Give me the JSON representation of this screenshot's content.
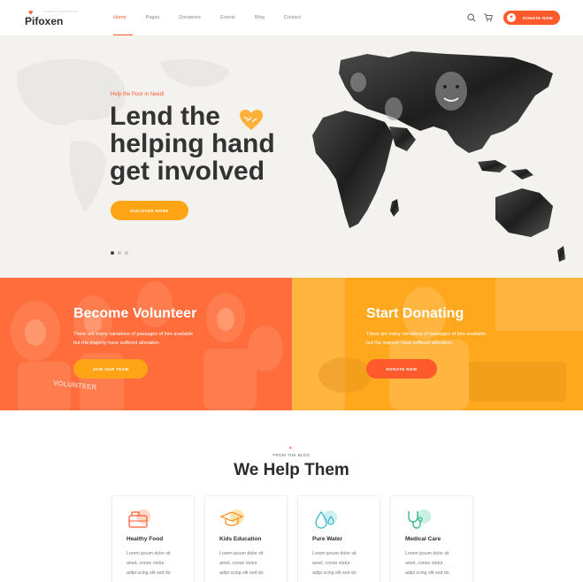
{
  "brand": {
    "name": "Pifoxen",
    "tagline": "CHARITY & DONATION"
  },
  "nav": {
    "items": [
      "Home",
      "Pages",
      "Donations",
      "Events",
      "Blog",
      "Contact"
    ],
    "active": "Home"
  },
  "header": {
    "donate_label": "DONATE NOW"
  },
  "hero": {
    "tagline": "Help the Poor in Need!",
    "title_line1": "Lend the",
    "title_line2": "helping hand",
    "title_line3": "get involved",
    "button_label": "DISCOVER MORE",
    "slides_count": 3,
    "active_slide": 1
  },
  "volunteer": {
    "title": "Become Volunteer",
    "text_line1": "There are many variations of passages of lore available",
    "text_line2": "but the majority have suffered alteration.",
    "button_label": "JOIN OUR TEAM",
    "photo_caption": "VOLUNTEER"
  },
  "donating": {
    "title": "Start Donating",
    "text_line1": "There are many variations of passages of lore available",
    "text_line2": "but the majority have suffered alteration.",
    "button_label": "DONATE NOW"
  },
  "help": {
    "subtitle": "FROM THE BLOG",
    "title": "We Help Them",
    "cards": [
      {
        "title": "Healthy Food",
        "icon": "food-icon",
        "line1": "Lorem ipsum dolor sit",
        "line2": "amet, conse ctetur",
        "line3": "adipi scing elit sed do"
      },
      {
        "title": "Kids Education",
        "icon": "graduation-cap-icon",
        "line1": "Lorem ipsum dolor sit",
        "line2": "amet, conse ctetur",
        "line3": "adipi scing elit sed do"
      },
      {
        "title": "Pure Water",
        "icon": "water-drop-icon",
        "line1": "Lorem ipsum dolor sit",
        "line2": "amet, conse ctetur",
        "line3": "adipi scing elit sed do"
      },
      {
        "title": "Medical Care",
        "icon": "stethoscope-icon",
        "line1": "Lorem ipsum dolor sit",
        "line2": "amet, conse ctetur",
        "line3": "adipi scing elit sed do"
      }
    ]
  },
  "colors": {
    "accent": "#ff5a2c",
    "orange": "#ffa414",
    "dark": "#2b2b2b"
  }
}
